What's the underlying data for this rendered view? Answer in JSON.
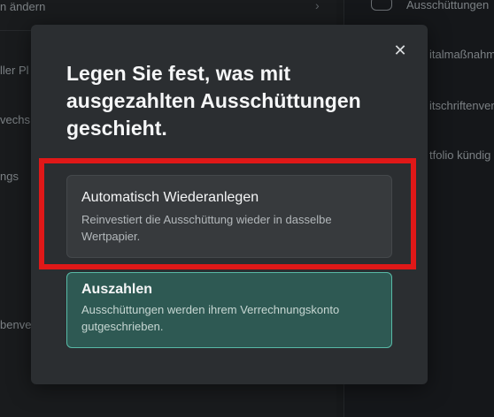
{
  "background": {
    "items": [
      "n ändern",
      "ller Pl",
      "vechs",
      "ngs",
      "benve"
    ],
    "right_items": [
      "Ausschüttungen",
      "italmaßnahmen",
      "itschriftenver",
      "tfolio kündig"
    ]
  },
  "modal": {
    "close_label": "✕",
    "title": "Legen Sie fest, was mit ausgezahlten Ausschüttungen geschieht.",
    "options": [
      {
        "title": "Automatisch Wiederanlegen",
        "description": "Reinvestiert die Ausschüttung wieder in dasselbe Wertpapier."
      },
      {
        "title": "Auszahlen",
        "description": "Ausschüttungen werden ihrem Verrechnungskonto gutgeschrieben."
      }
    ]
  },
  "colors": {
    "highlight": "#e01818",
    "selected_border": "#58b9a6"
  }
}
